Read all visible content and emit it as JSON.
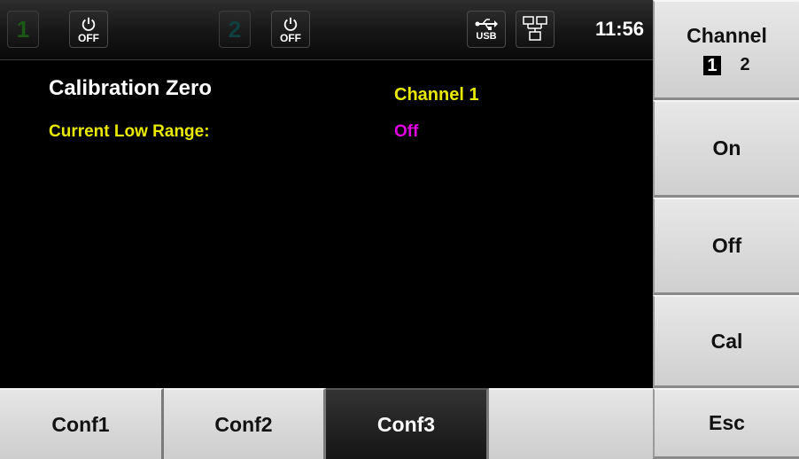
{
  "status_bar": {
    "channel1_number": "1",
    "channel1_power": "OFF",
    "channel1_power_icon": "power-icon",
    "channel2_number": "2",
    "channel2_power": "OFF",
    "channel2_power_icon": "power-icon",
    "usb_label": "USB",
    "usb_icon": "usb-icon",
    "network_icon": "network-icon",
    "time": "11:56"
  },
  "content": {
    "title": "Calibration Zero",
    "channel_label": "Channel 1",
    "range_label": "Current Low Range:",
    "range_value": "Off",
    "colors": {
      "label_yellow": "#e8e800",
      "value_magenta": "#e000e0"
    }
  },
  "softkeys": {
    "channel_title": "Channel",
    "channel_options": [
      "1",
      "2"
    ],
    "channel_selected": "1",
    "on_label": "On",
    "off_label": "Off",
    "cal_label": "Cal",
    "esc_label": "Esc"
  },
  "bottom_menu": {
    "items": [
      {
        "label": "Conf1",
        "active": false
      },
      {
        "label": "Conf2",
        "active": false
      },
      {
        "label": "Conf3",
        "active": true
      },
      {
        "label": "",
        "active": false
      }
    ]
  }
}
